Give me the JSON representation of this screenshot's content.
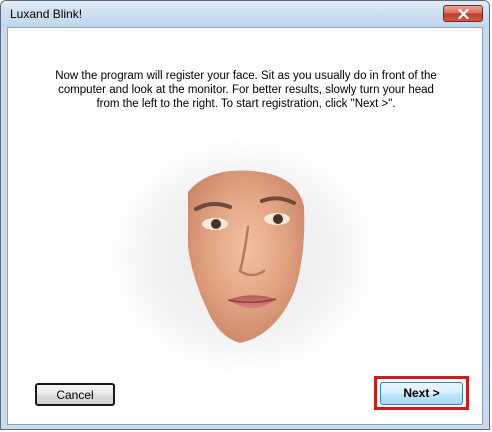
{
  "window": {
    "title": "Luxand Blink!"
  },
  "content": {
    "instructions": "Now the program will register your face. Sit as you usually do in front of the computer and look at the monitor. For better results, slowly turn your head from the left to the right. To start registration, click \"Next >\"."
  },
  "buttons": {
    "cancel_label": "Cancel",
    "next_label": "Next >"
  },
  "colors": {
    "highlight": "#d11a1a",
    "titlebar": "#c9dbee",
    "close_button": "#c0392b"
  }
}
